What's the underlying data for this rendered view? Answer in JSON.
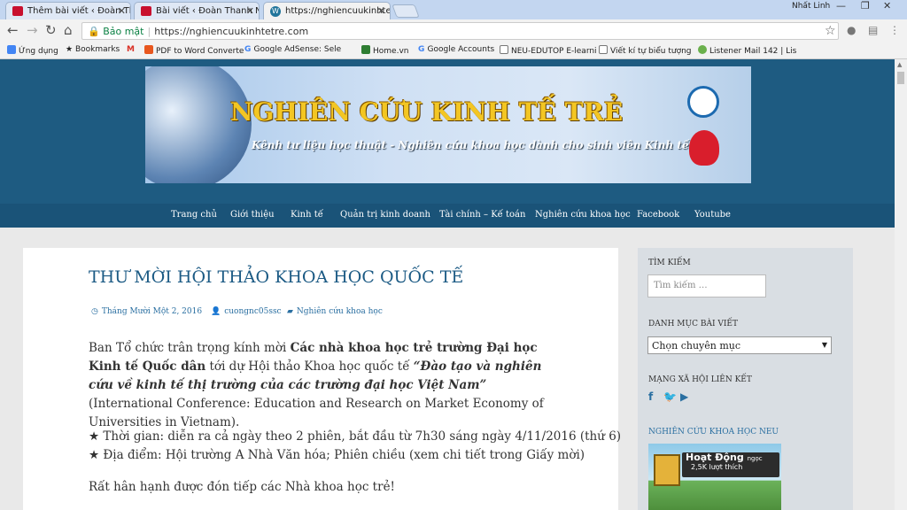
{
  "browser": {
    "tabs": [
      {
        "title": "Thêm bài viết ‹ Đoàn Thanh"
      },
      {
        "title": "Bài viết ‹ Đoàn Thanh Niê"
      },
      {
        "title": "https://nghiencuukinhte"
      }
    ],
    "user_name": "Nhất Linh",
    "secure_label": "Bảo mật",
    "url": "https://nghiencuukinhtetre.com",
    "bookmarks": [
      {
        "label": "Ứng dụng",
        "icon": "apps-icon",
        "color": "#4285f4"
      },
      {
        "label": "Bookmarks",
        "icon": "star-icon",
        "color": "#555555"
      },
      {
        "label": "",
        "icon": "gmail-icon",
        "color": "#d93025"
      },
      {
        "label": "PDF to Word Converte",
        "icon": "pdf-icon",
        "color": "#e8571e"
      },
      {
        "label": "Google AdSense: Sele",
        "icon": "google-icon",
        "color": "#4285f4"
      },
      {
        "label": "Home.vn",
        "icon": "homevn-icon",
        "color": "#2e7d32"
      },
      {
        "label": "Google Accounts",
        "icon": "google-icon",
        "color": "#4285f4"
      },
      {
        "label": "NEU-EDUTOP E-learni",
        "icon": "page-icon",
        "color": "#777777"
      },
      {
        "label": "Viết kí tự biểu tượng",
        "icon": "page-icon",
        "color": "#777777"
      },
      {
        "label": "Listener Mail 142 | Lis",
        "icon": "listener-icon",
        "color": "#6ab04c"
      }
    ]
  },
  "site": {
    "banner_title": "NGHIÊN CỨU KINH TẾ TRẺ",
    "banner_subtitle": "Kênh tư liệu học thuật - Nghiên cứu khoa học dành cho sinh viên Kinh tế",
    "menu": [
      "Trang chủ",
      "Giới thiệu",
      "Kinh tế",
      "Quản trị kinh doanh",
      "Tài chính – Kế toán",
      "Nghiên cứu khoa học",
      "Facebook",
      "Youtube"
    ]
  },
  "post": {
    "title": "THƯ MỜI HỘI THẢO KHOA HỌC QUỐC TẾ",
    "date": "Tháng Mười Một 2, 2016",
    "author": "cuongnc05ssc",
    "category": "Nghiên cứu khoa học",
    "p1_intro": "Ban Tổ chức trân trọng kính mời ",
    "p1_bold": "Các nhà khoa học trẻ trường Đại học Kinh tế Quốc dân",
    "p1_mid": " tới dự Hội thảo Khoa học quốc tế ",
    "p1_quote": "“Đào tạo và nghiên cứu về kinh tế thị trường của các trường đại học Việt Nam”",
    "p1_end": " (International Conference: Education and Research on Market Economy of Universities in Vietnam).",
    "p2_line1": "★ Thời gian: diễn ra cả ngày theo 2 phiên, bắt đầu từ 7h30 sáng ngày 4/11/2016 (thứ 6)",
    "p2_line2": "★ Địa điểm: Hội trường A Nhà Văn hóa; Phiên chiều (xem chi tiết trong Giấy mời)",
    "p3": "Rất hân hạnh được đón tiếp các Nhà khoa học trẻ!"
  },
  "sidebar": {
    "search_heading": "TÌM KIẾM",
    "search_placeholder": "Tìm kiếm …",
    "category_heading": "DANH MỤC BÀI VIẾT",
    "category_selected": "Chọn chuyên mục",
    "social_heading": "MẠNG XÃ HỘI LIÊN KẾT",
    "neu_heading": "NGHIÊN CỨU KHOA HỌC NEU",
    "widget_title": "Hoạt Động",
    "widget_small": "ngọc",
    "widget_count": "2,5K lượt thích"
  }
}
